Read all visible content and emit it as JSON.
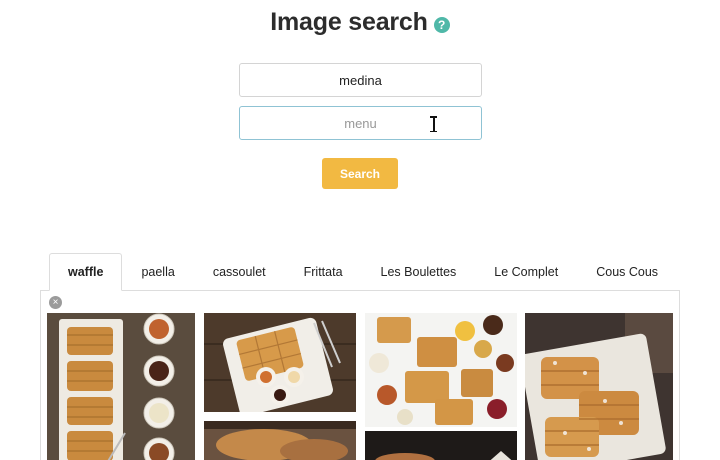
{
  "header": {
    "title": "Image search",
    "help_icon": "help-icon"
  },
  "search": {
    "query_value": "medina",
    "context_placeholder": "menu",
    "button_label": "Search"
  },
  "tabs": [
    {
      "label": "waffle",
      "active": true
    },
    {
      "label": "paella",
      "active": false
    },
    {
      "label": "cassoulet",
      "active": false
    },
    {
      "label": "Frittata",
      "active": false
    },
    {
      "label": "Les Boulettes",
      "active": false
    },
    {
      "label": "Le Complet",
      "active": false
    },
    {
      "label": "Cous Cous",
      "active": false
    }
  ],
  "colors": {
    "accent": "#f2b942",
    "help": "#4fb8a8",
    "focus_border": "#8fc3d4"
  },
  "results": {
    "close_icon": "close-icon"
  }
}
